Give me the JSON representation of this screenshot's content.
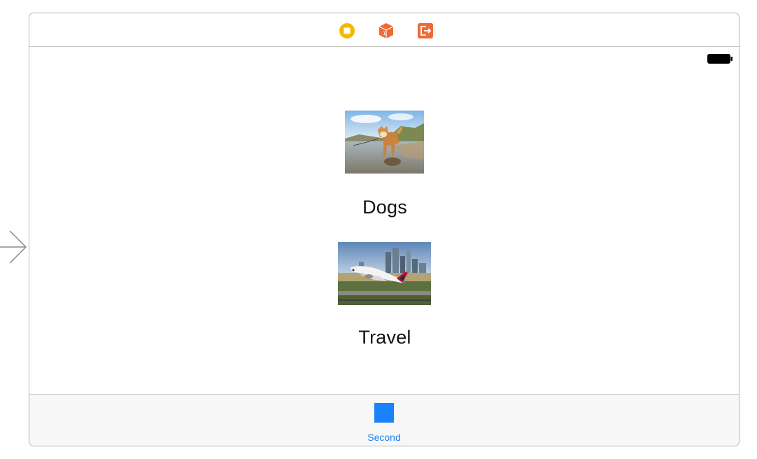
{
  "colors": {
    "accent": "#1a82fb",
    "view_controller_icon": "#f5b800",
    "object_icon": "#f06a35",
    "exit_icon": "#f06a35",
    "frame_border": "#b7b7b7",
    "tab_bar_background": "#f7f7f7"
  },
  "dock": {
    "icons": [
      "view-controller-icon",
      "first-responder-icon",
      "exit-icon"
    ]
  },
  "status_bar": {
    "icons": [
      "battery-icon"
    ]
  },
  "content": {
    "items": [
      {
        "label": "Dogs",
        "image": "dog-photo"
      },
      {
        "label": "Travel",
        "image": "airplane-photo"
      }
    ]
  },
  "tab_bar": {
    "items": [
      {
        "label": "Second",
        "icon": "square-tab-icon",
        "selected": true
      }
    ]
  }
}
